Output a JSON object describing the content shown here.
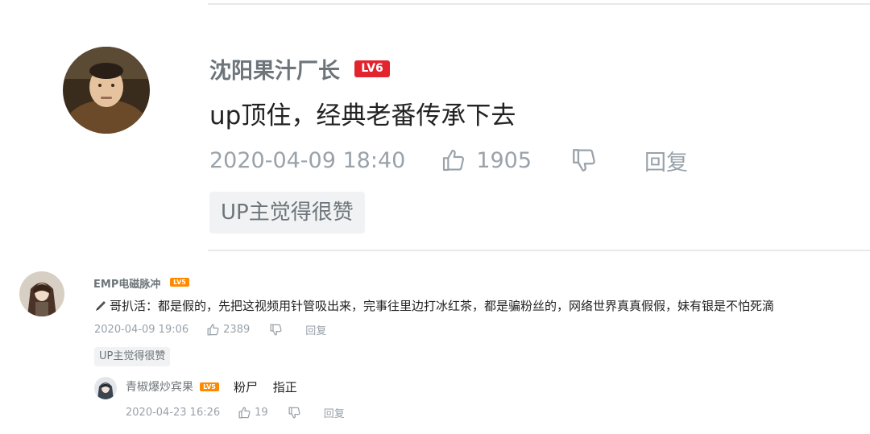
{
  "comment_main": {
    "username": "沈阳果汁厂长",
    "level": "LV6",
    "text": "up顶住，经典老番传承下去",
    "timestamp": "2020-04-09 18:40",
    "likes": "1905",
    "reply_label": "回复",
    "badge": "UP主觉得很赞",
    "level_color": "#e2242f"
  },
  "comment_second": {
    "username": "EMP电磁脉冲",
    "level": "LV5",
    "text": "哥扒活：都是假的，先把这视频用针管吸出来，完事往里边打冰红茶，都是骗粉丝的，网络世界真真假假，妹有银是不怕死滴",
    "timestamp": "2020-04-09 19:06",
    "likes": "2389",
    "reply_label": "回复",
    "badge": "UP主觉得很赞",
    "level_color": "#ff8a00"
  },
  "reply": {
    "username": "青椒爆炒宾果",
    "level": "LV5",
    "text": "粉尸 指正",
    "timestamp": "2020-04-23 16:26",
    "likes": "19",
    "reply_label": "回复"
  },
  "icons": {
    "like": "thumbs-up-icon",
    "dislike": "thumbs-down-icon",
    "prefix": "pen-icon"
  },
  "colors": {
    "meta_gray": "#99a2aa",
    "name_gray": "#6d757a",
    "badge_bg": "#f1f2f3"
  }
}
